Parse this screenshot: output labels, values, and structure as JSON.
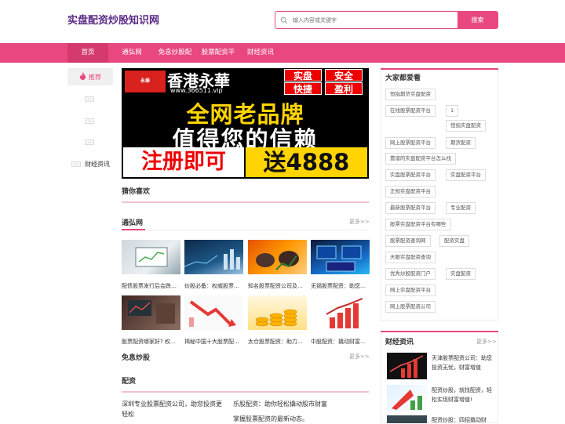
{
  "header": {
    "logo": "实盘配资炒股知识网",
    "search_placeholder": "输入内容或关键字",
    "search_button": "搜索"
  },
  "nav": {
    "items": [
      "首页",
      "通弘网",
      "免息炒股配",
      "股票配资平",
      "财经资讯"
    ],
    "active": "首页"
  },
  "left": {
    "recommend": "推荐",
    "placeholders": [
      "…",
      "…",
      "…",
      "…"
    ],
    "finance_link": "财经资讯"
  },
  "banner": {
    "brand": "香港永華",
    "url": "www.366511.vip",
    "tags": [
      "实盘",
      "安全",
      "快捷",
      "盈利"
    ],
    "line1": "全网老品牌",
    "line2": "值得您的信赖",
    "line3a": "注册即可",
    "line3b": "送4888",
    "logo_text": "永華"
  },
  "sections": {
    "guess": "猜你喜欢",
    "tonghong": "通弘网",
    "more": "更多>>",
    "free": "免息炒股",
    "peizi": "配资"
  },
  "articles": [
    "配债股票发行后会跌…",
    "炒股必备：权威股票…",
    "知名股票配资公司及…",
    "无锡股票配资：助您…",
    "股票配资哪家好? 权…",
    "揭秘中国十大股票配…",
    "太仓股票配资：助力…",
    "中股配资：撬动财富…"
  ],
  "peizi_items": [
    "深圳专业股票配资公司，助您投资更轻松",
    "乐股配资：助你轻松撬动股市财富",
    "掌握股票配资的最新动态。"
  ],
  "right": {
    "popular_title": "大家都爱看",
    "tags": [
      "恒指期货实盘配资",
      "在线股票配资平台",
      "1",
      "恒指实盘配资",
      "网上股票配资平台",
      "期货配资",
      "靠谱的实盘配资平台怎么找",
      "实盘股票配资平台",
      "实盘配资平台",
      "正规实盘配资平台",
      "最新股票配资平台",
      "专业配资",
      "股票实盘配资平台有哪些",
      "股票配资查询网",
      "配资实盘",
      "天眼实盘配资查询",
      "优秀炒股配资门户",
      "实盘配资",
      "网上实盘配资平台",
      "网上股票配资公司"
    ],
    "finance_title": "财经资讯",
    "finance_more": "更多>>",
    "finance_items": [
      "天津股票配资公司：助您投资无忧，财富增值",
      "配资炒股，就找配资，轻松实现财富增值!",
      "配资炒股：四招撬动财"
    ]
  },
  "colors": {
    "accent": "#e8477f",
    "logo": "#5b2a86"
  }
}
